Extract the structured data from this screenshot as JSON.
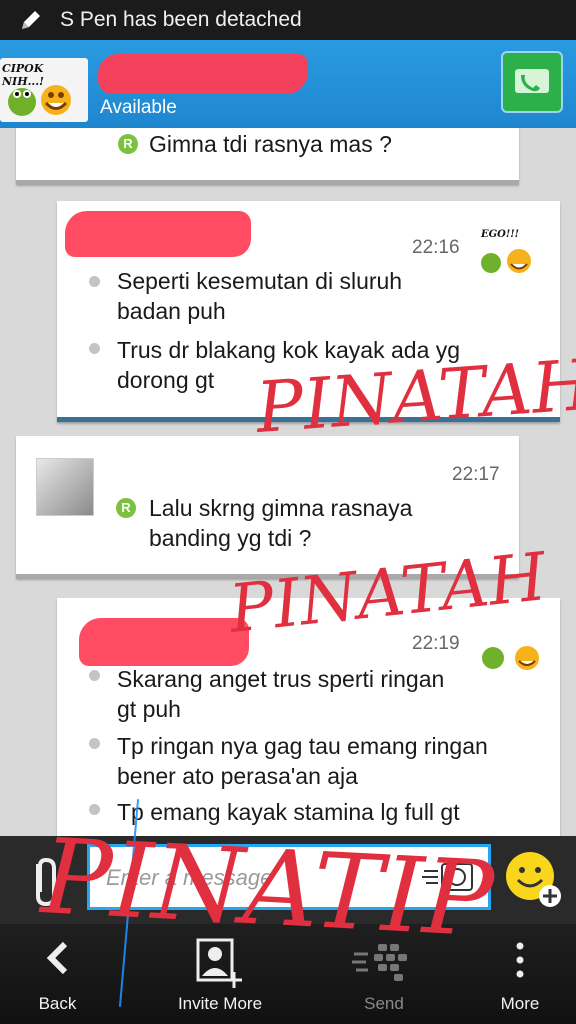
{
  "notification": {
    "text": "S Pen has been detached",
    "icon": "pencil-icon"
  },
  "header": {
    "avatar_caption": "CIPOK NIH...!",
    "status": "Available",
    "call_icon": "phone-icon"
  },
  "messages": [
    {
      "type": "incoming",
      "lines": [
        "Gimna tdi rasnya mas ?"
      ]
    },
    {
      "type": "outgoing",
      "time": "22:16",
      "sticker_caption": "EGO!!!",
      "bullets": [
        "Seperti kesemutan di sluruh badan puh",
        "Trus dr blakang kok kayak ada yg dorong gt"
      ]
    },
    {
      "type": "incoming",
      "time": "22:17",
      "lines": [
        "Lalu skrng gimna rasnaya banding yg tdi ?"
      ]
    },
    {
      "type": "outgoing",
      "time": "22:19",
      "bullets": [
        "Skarang anget trus sperti ringan gt puh",
        "Tp ringan nya gag tau emang ringan bener ato perasa'an aja",
        "Tp emang kayak stamina lg full gt"
      ]
    }
  ],
  "compose": {
    "placeholder": "Enter a message"
  },
  "nav": {
    "back": "Back",
    "invite": "Invite More",
    "send": "Send",
    "more": "More"
  },
  "scribbles": [
    "PINATAH",
    "PINATAH",
    "PINATIP"
  ],
  "colors": {
    "accent": "#27a6f0",
    "header": "#1e86cf",
    "redaction": "#ff3d55",
    "ink": "#e0303f"
  }
}
